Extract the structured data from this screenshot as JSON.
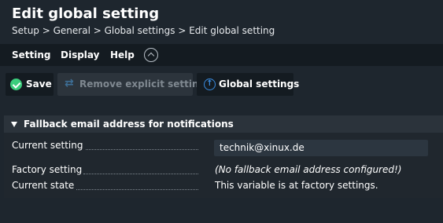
{
  "page": {
    "title": "Edit global setting",
    "breadcrumb": "Setup > General > Global settings > Edit global setting"
  },
  "menu": {
    "items": [
      {
        "label": "Setting"
      },
      {
        "label": "Display"
      },
      {
        "label": "Help"
      }
    ],
    "collapse_icon": "chevron-up-circle-icon"
  },
  "toolbar": {
    "save": {
      "label": "Save",
      "icon": "check-circle-icon",
      "color": "#3bcd7c"
    },
    "remove": {
      "label": "Remove explicit setting",
      "icon": "reset-arrows-icon",
      "disabled": true
    },
    "global": {
      "label": "Global settings",
      "icon": "info-circle-icon",
      "color": "#3a8ce0"
    }
  },
  "section": {
    "title": "Fallback email address for notifications",
    "rows": [
      {
        "label": "Current setting",
        "value": "technik@xinux.de",
        "editable": true
      },
      {
        "label": "Factory setting",
        "value": "(No fallback email address configured!)",
        "italic": true
      },
      {
        "label": "Current state",
        "value": "This variable is at factory settings."
      }
    ]
  }
}
